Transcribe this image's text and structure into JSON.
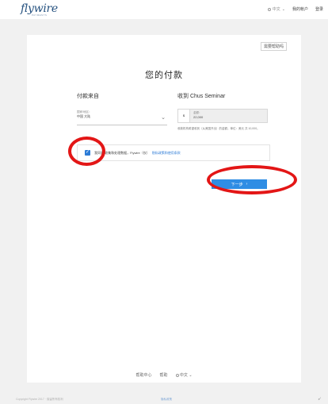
{
  "header": {
    "logo_text": "flywire",
    "logo_sub": "PAYMENTS",
    "language_label": "中文",
    "nav_link_1": "我的帐户",
    "nav_link_2": "登录"
  },
  "card": {
    "help_button": "需要帮助吗",
    "title": "您的付款",
    "from_heading": "付款来自",
    "to_heading": "收到 Chus Seminar",
    "from_field_label": "国家/地区：",
    "from_field_value": "中国 大陆",
    "currency_label": "$",
    "amount_label": "金额：",
    "amount_value": "22,000",
    "amount_note": "收款机构希望收到（从美国开出）的金额。单位：美元 共 10,000。",
    "consent_text": "我同意 收集和处理数据，Flywire（仅）",
    "consent_link": "隐私政策和使用条款",
    "next_button": "下一步",
    "next_arrow": "›"
  },
  "footer": {
    "link_help": "帮助中心",
    "link_support": "帮助",
    "language": "中文"
  },
  "bottom": {
    "copyright": "Copyright Flywire 2017 · 保留所有权利",
    "link": "隐私政策"
  },
  "colors": {
    "accent": "#2f8de4",
    "annotation": "#e31616",
    "logo": "#25517f"
  },
  "icons": {
    "chevron": "chevron-down-icon",
    "checkbox": "checkmark-icon",
    "globe": "globe-icon",
    "corner": "cursor-icon"
  }
}
